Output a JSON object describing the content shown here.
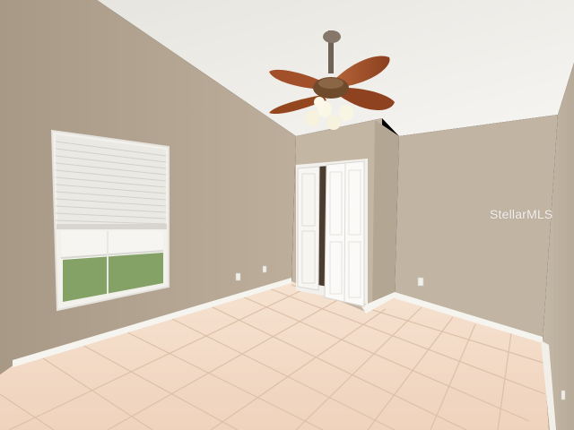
{
  "watermark": {
    "text": "StellarMLS"
  },
  "colors": {
    "wall_left": "#b6a794",
    "wall_back": "#c2b5a2",
    "wall_right": "#c0b4a3",
    "ceiling": "#f0efeb",
    "floor": "#f3d9c4",
    "grout": "#ddc2ad",
    "baseboard": "#f4f2ee",
    "fan_blade": "#a4532b",
    "window_sky": "#f5f4f1",
    "grass": "#7f9e63"
  },
  "icons": {
    "fan": "ceiling-fan-icon",
    "outlet": "outlet-icon"
  }
}
